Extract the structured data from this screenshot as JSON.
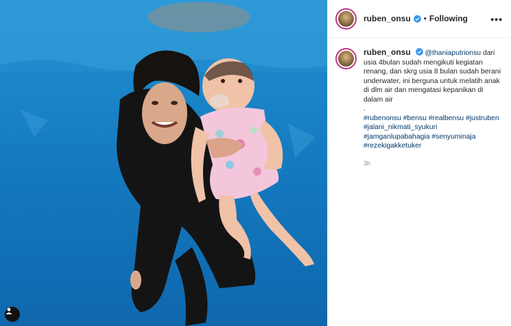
{
  "post": {
    "author": "ruben_onsu",
    "verified": true,
    "follow_status": "Following",
    "separator": "•",
    "more_label": "•••",
    "caption": {
      "mention": "@thaniaputrionsu",
      "text": " dari usia 4bulan sudah mengikuti kegiatan renang, dan skrg usia 8 bulan sudah berani underwater, ini berguna untuk melatih anak di dlm air dan mengatasi kepanikan di dalam air",
      "dot_line": ".",
      "hashtags": [
        "#rubenonsu",
        "#bensu",
        "#realbensu",
        "#justruben",
        "#jalani_nikmati_syukuri",
        "#jamganlupabahagia",
        "#senyuminaja",
        "#rezekigakketuker"
      ]
    },
    "timestamp": "3h"
  },
  "icons": {
    "verified": "verified-badge-icon",
    "more": "more-options-icon",
    "user_tag": "user-tag-icon"
  },
  "colors": {
    "link": "#00376b",
    "verified": "#3897f0",
    "story_ring": "#c13584",
    "water": "#1a86c9"
  }
}
